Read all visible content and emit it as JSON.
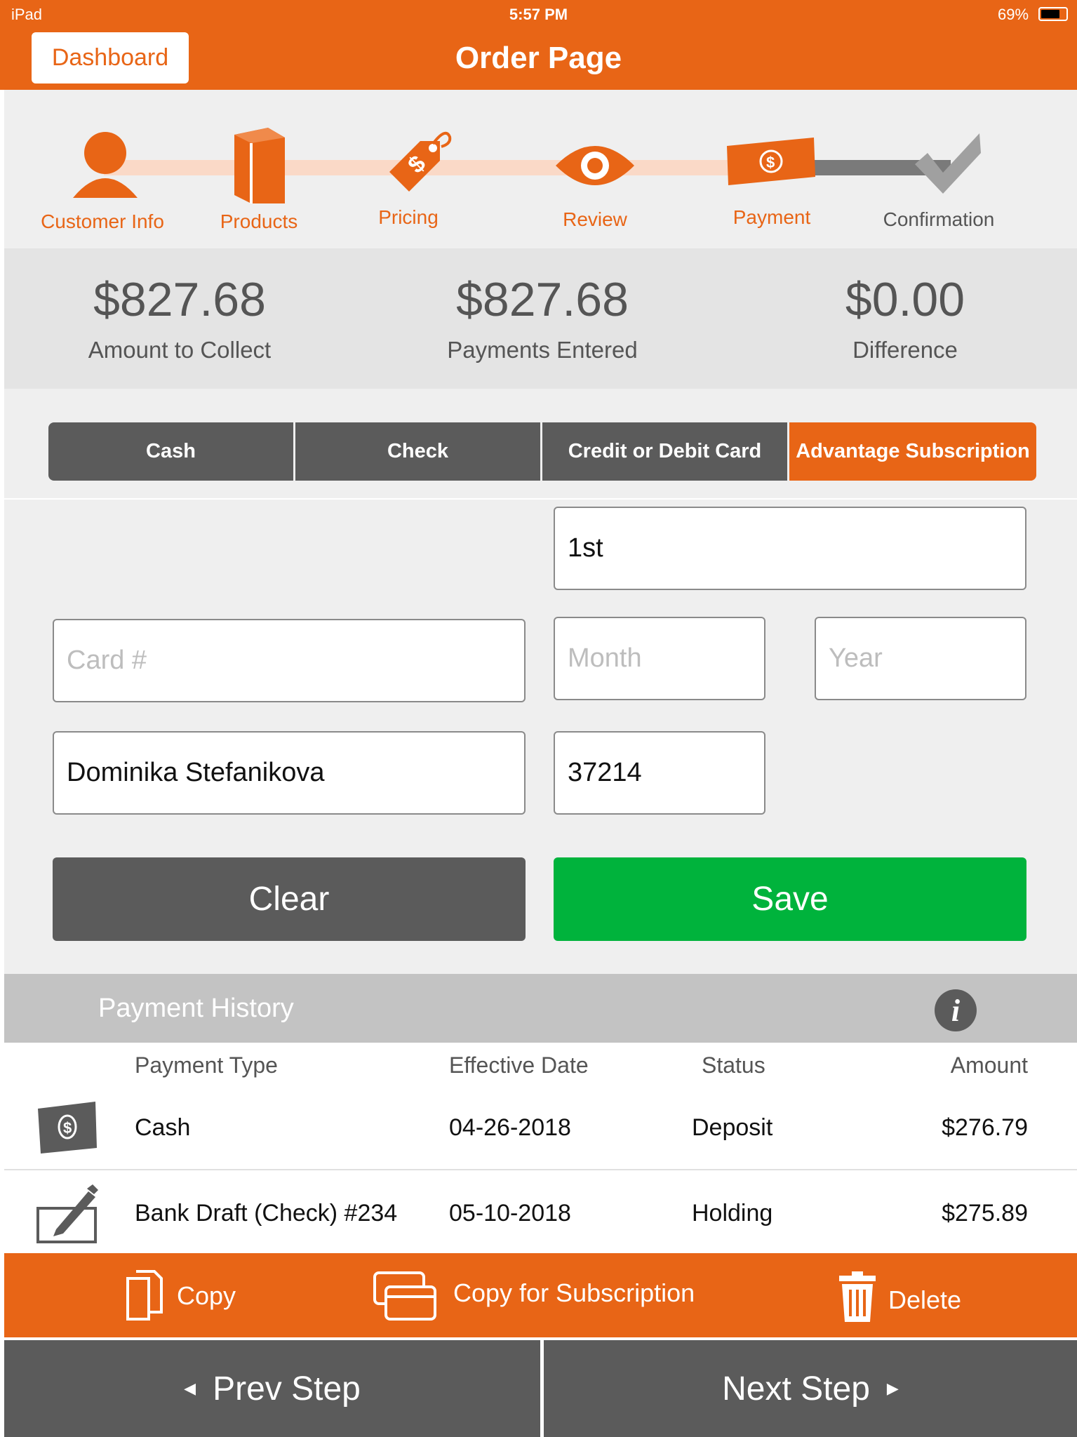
{
  "status_bar": {
    "device": "iPad",
    "time": "5:57 PM",
    "battery": "69%"
  },
  "header": {
    "dashboard_label": "Dashboard",
    "title": "Order Page"
  },
  "steps": [
    {
      "label": "Customer Info",
      "icon": "person-icon"
    },
    {
      "label": "Products",
      "icon": "book-icon"
    },
    {
      "label": "Pricing",
      "icon": "price-tag-icon"
    },
    {
      "label": "Review",
      "icon": "eye-icon"
    },
    {
      "label": "Payment",
      "icon": "money-icon"
    },
    {
      "label": "Confirmation",
      "icon": "checkmark-icon"
    }
  ],
  "totals": {
    "amount_to_collect": {
      "value": "$827.68",
      "label": "Amount to Collect"
    },
    "payments_entered": {
      "value": "$827.68",
      "label": "Payments Entered"
    },
    "difference": {
      "value": "$0.00",
      "label": "Difference"
    }
  },
  "payment_tabs": {
    "cash": "Cash",
    "check": "Check",
    "card": "Credit or Debit Card",
    "subscription": "Advantage Subscription",
    "active": "Advantage Subscription"
  },
  "form": {
    "charge_day": {
      "value": "1st"
    },
    "card_number": {
      "placeholder": "Card #",
      "value": ""
    },
    "month": {
      "placeholder": "Month",
      "value": ""
    },
    "year": {
      "placeholder": "Year",
      "value": ""
    },
    "name": {
      "value": "Dominika Stefanikova"
    },
    "zip": {
      "value": "37214"
    },
    "clear_label": "Clear",
    "save_label": "Save"
  },
  "payment_history": {
    "title": "Payment History",
    "info_icon": "info-icon",
    "columns": {
      "type": "Payment Type",
      "date": "Effective Date",
      "status": "Status",
      "amount": "Amount"
    },
    "rows": [
      {
        "icon": "cash-icon",
        "type": "Cash",
        "date": "04-26-2018",
        "status": "Deposit",
        "amount": "$276.79"
      },
      {
        "icon": "check-pen-icon",
        "type": "Bank Draft (Check) #234",
        "date": "05-10-2018",
        "status": "Holding",
        "amount": "$275.89"
      }
    ]
  },
  "actions": {
    "copy": "Copy",
    "copy_subscription": "Copy for Subscription",
    "delete": "Delete"
  },
  "navigation": {
    "prev": "Prev Step",
    "next": "Next Step"
  },
  "colors": {
    "accent": "#E86516",
    "save": "#00B33C",
    "dark_button": "#5B5B5B",
    "track_done": "#FAD9C7"
  }
}
